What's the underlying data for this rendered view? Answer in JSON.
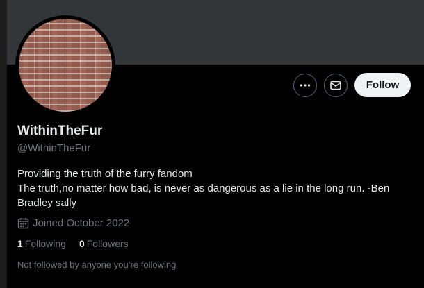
{
  "profile": {
    "display_name": "WithinTheFur",
    "handle": "@WithinTheFur",
    "bio_line1": "Providing the truth of the furry fandom",
    "bio_line2": "The truth,no matter how bad, is never as dangerous as a lie in the long run.  -Ben",
    "bio_line3": "Bradley sally",
    "joined": "Joined October 2022",
    "following_count": "1",
    "following_label": "Following",
    "followers_count": "0",
    "followers_label": "Followers",
    "not_followed_note": "Not followed by anyone you’re following"
  },
  "actions": {
    "more_icon": "more-dots-icon",
    "message_icon": "envelope-icon",
    "follow_label": "Follow"
  },
  "colors": {
    "background": "#000000",
    "banner": "#333639",
    "follow_button": "#eff3f4",
    "secondary_text": "#71767b",
    "primary_text": "#e7e9ea"
  }
}
